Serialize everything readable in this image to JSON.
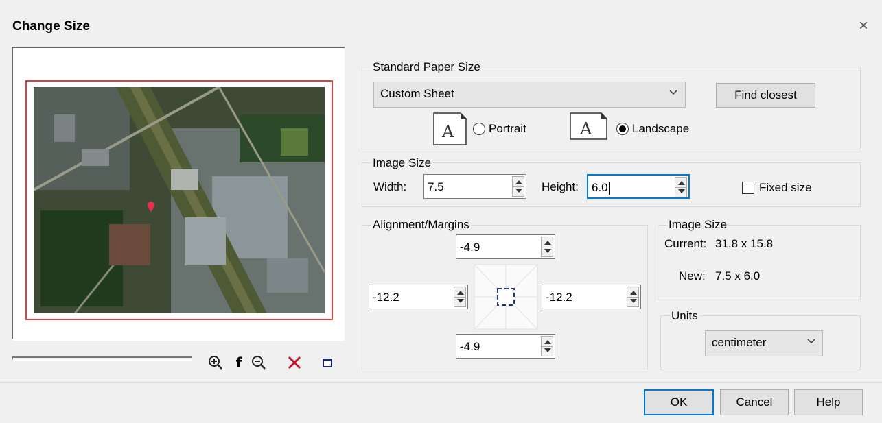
{
  "window": {
    "title": "Change Size",
    "close_icon": "close-icon"
  },
  "preview": {
    "toolbar": {
      "zoom_in_icon": "zoom-in-icon",
      "fit_icon": "f",
      "zoom_out_icon": "zoom-out-icon",
      "delete_icon": "delete-icon",
      "frame_icon": "frame-icon"
    }
  },
  "standard_paper_size": {
    "group_label": "Standard Paper Size",
    "selected": "Custom Sheet",
    "find_closest_label": "Find closest",
    "portrait_label": "Portrait",
    "landscape_label": "Landscape",
    "orientation": "landscape",
    "orientation_icon_glyph": "A"
  },
  "image_size": {
    "group_label": "Image Size",
    "width_label": "Width:",
    "width_value": "7.5",
    "height_label": "Height:",
    "height_value": "6.0",
    "fixed_size_label": "Fixed size",
    "fixed_size_checked": false
  },
  "alignment": {
    "group_label": "Alignment/Margins",
    "top": "-4.9",
    "left": "-12.2",
    "right": "-12.2",
    "bottom": "-4.9"
  },
  "image_size_info": {
    "group_label": "Image Size",
    "current_label": "Current:",
    "current_value": "31.8 x 15.8",
    "new_label": "New:",
    "new_value": "7.5 x 6.0"
  },
  "units": {
    "group_label": "Units",
    "selected": "centimeter"
  },
  "buttons": {
    "ok": "OK",
    "cancel": "Cancel",
    "help": "Help"
  },
  "colors": {
    "accent": "#0078d7",
    "frame_border": "#e04040",
    "delete": "#c8102e"
  }
}
